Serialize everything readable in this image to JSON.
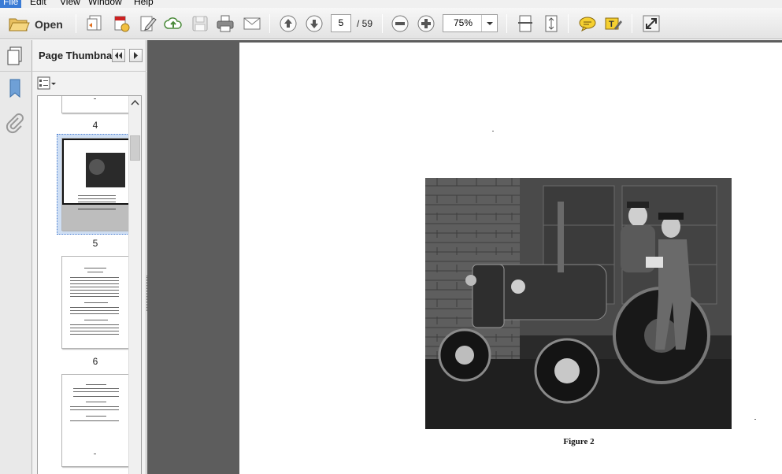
{
  "menubar": {
    "items": [
      "File",
      "Edit",
      "View",
      "Window",
      "Help"
    ]
  },
  "toolbar": {
    "open_label": "Open",
    "current_page": "5",
    "page_total": "/ 59",
    "zoom": "75%",
    "icons": [
      "open-folder-icon",
      "create-pdf-icon",
      "convert-icon",
      "edit-icon",
      "cloud-upload-icon",
      "save-icon",
      "print-icon",
      "email-icon",
      "previous-page-icon",
      "next-page-icon",
      "zoom-out-icon",
      "zoom-in-icon",
      "scroll-mode-icon",
      "fit-page-icon",
      "comment-icon",
      "highlight-text-icon",
      "expand-icon"
    ]
  },
  "panel": {
    "title": "Page Thumbna...",
    "thumbnails": [
      {
        "label": "4",
        "selected": false
      },
      {
        "label": "5",
        "selected": true
      },
      {
        "label": "6",
        "selected": false
      },
      {
        "label": "",
        "selected": false
      }
    ]
  },
  "document": {
    "caption": "Figure 2"
  },
  "colors": {
    "accent": "#3a7bd5",
    "document_background": "#5d5d5d",
    "selection": "#cfdff4"
  }
}
